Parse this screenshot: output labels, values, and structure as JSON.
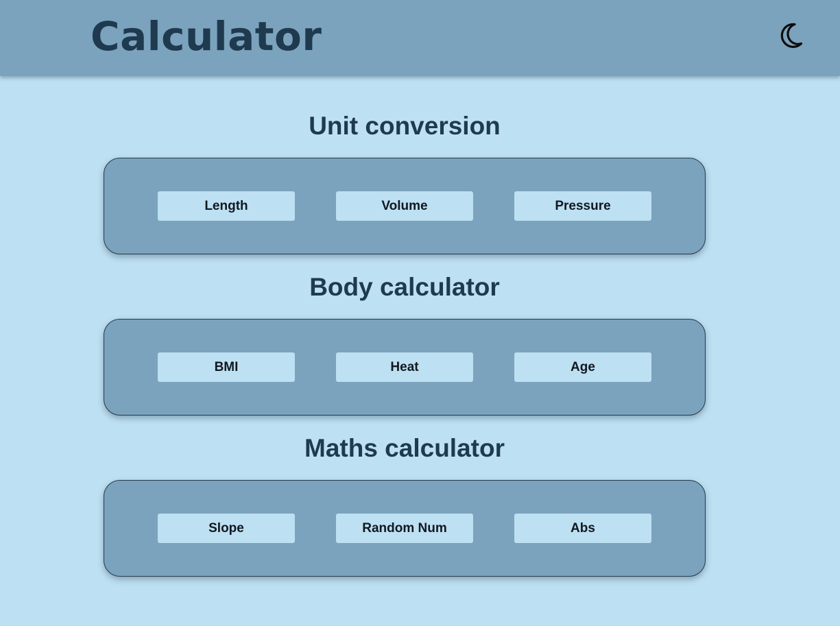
{
  "header": {
    "title": "Calculator",
    "theme_toggle_icon": "moon-icon"
  },
  "sections": [
    {
      "title": "Unit conversion",
      "buttons": [
        "Length",
        "Volume",
        "Pressure"
      ]
    },
    {
      "title": "Body calculator",
      "buttons": [
        "BMI",
        "Heat",
        "Age"
      ]
    },
    {
      "title": "Maths calculator",
      "buttons": [
        "Slope",
        "Random Num",
        "Abs"
      ]
    }
  ],
  "colors": {
    "page_background": "#bde0f2",
    "header_background": "#7ba3bd",
    "card_background": "#7ba3bd",
    "title_text": "#1f3a4f",
    "button_background": "#bde0f2",
    "button_text": "#111820"
  }
}
